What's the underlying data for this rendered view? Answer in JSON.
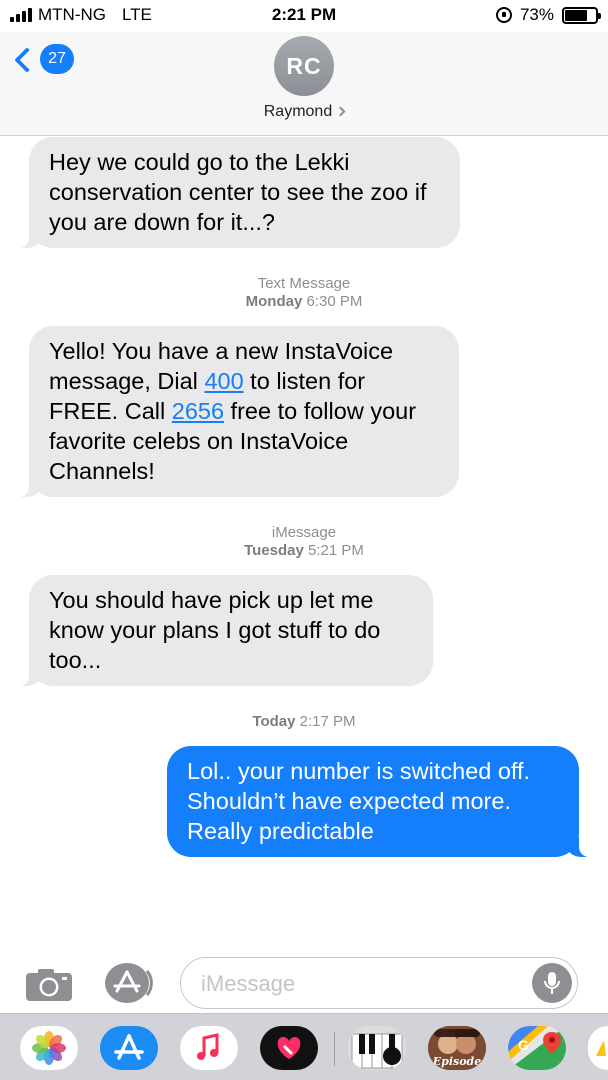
{
  "status_bar": {
    "carrier": "MTN-NG",
    "network": "LTE",
    "time": "2:21 PM",
    "battery_percent": "73%",
    "battery_level": 0.73
  },
  "header": {
    "back_badge": "27",
    "avatar_initials": "RC",
    "contact_name": "Raymond"
  },
  "thread": {
    "message_1": {
      "sender": "incoming",
      "text": "Hey we could go to the Lekki conservation center to see the zoo if you are down for it...?"
    },
    "divider_1": {
      "service": "Text Message",
      "day": "Monday",
      "time": "6:30 PM"
    },
    "message_2": {
      "sender": "incoming",
      "part_1": "Yello! You have a new InstaVoice message, Dial ",
      "link_1": "400",
      "part_2": " to listen for FREE. Call ",
      "link_2": "2656",
      "part_3": " free to follow your favorite celebs on InstaVoice Channels!"
    },
    "divider_2": {
      "service": "iMessage",
      "day": "Tuesday",
      "time": "5:21 PM"
    },
    "message_3": {
      "sender": "incoming",
      "text": "You should have pick up let me know your plans I got stuff to do too..."
    },
    "divider_3": {
      "day": "Today",
      "time": "2:17 PM"
    },
    "message_4": {
      "sender": "outgoing",
      "text": "Lol.. your number is switched off. Shouldn’t have expected more. Really predictable"
    }
  },
  "input_bar": {
    "placeholder": "iMessage",
    "camera_icon": "camera-icon",
    "apps_icon": "app-store-icon",
    "mic_icon": "microphone-icon"
  },
  "app_drawer": {
    "apps": [
      "photos",
      "app-store",
      "music",
      "digital-touch",
      "piano",
      "episode",
      "google-maps",
      "partial-app"
    ],
    "episode_label": "Episode"
  },
  "colors": {
    "accent": "#147efb",
    "incoming_bubble": "#e9e9eb",
    "outgoing_bubble": "#147efb",
    "header_bg": "#f7f7f7",
    "drawer_bg": "#d1d3d9"
  }
}
